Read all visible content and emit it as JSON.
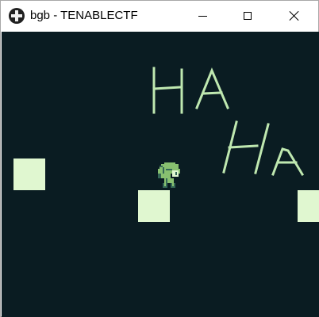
{
  "window": {
    "title": "bgb - TENABLECTF",
    "icon": "bgb-cross-icon"
  },
  "controls": {
    "minimize": "minimize-icon",
    "maximize": "maximize-icon",
    "close": "close-icon"
  },
  "game": {
    "handwriting": [
      "HA",
      "Ha"
    ],
    "palette": {
      "background": "#0a1c22",
      "light": "#e0f7d0",
      "mid": "#88c070",
      "dark": "#346856"
    }
  }
}
